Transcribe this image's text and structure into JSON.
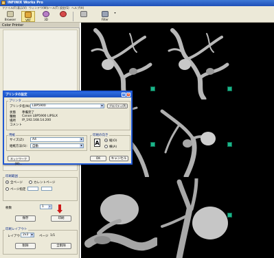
{
  "window": {
    "title": "INFINIX Works Pro"
  },
  "menu": [
    "ファイル(F)",
    "表示(V)",
    "ウィンドウ(W)",
    "ツール(T)",
    "設定(S)",
    "ヘルプ(H)"
  ],
  "toolbar": {
    "buttons": [
      {
        "label": "Browser",
        "icon": "browser-icon"
      },
      {
        "label": "VRT",
        "icon": "vrt-icon"
      },
      {
        "label": "3D",
        "icon": "3d-icon"
      },
      {
        "label": "",
        "icon": "hand-icon"
      },
      {
        "label": "",
        "icon": "monitor-icon"
      },
      {
        "label": "Filter",
        "icon": "filter-icon"
      }
    ]
  },
  "left_panel": {
    "header": "Color Printer",
    "print_range": {
      "title": "印刷範囲",
      "all_pages": "全ページ",
      "current_page": "カレントページ",
      "page_spec": "ページ指定"
    },
    "copies": {
      "label": "枚数",
      "value": "1"
    },
    "save_button": "保存",
    "print_button": "印刷",
    "layout": {
      "title": "印刷レイアウト",
      "layout_label": "レイアウト",
      "layout_value": "2x3",
      "page_label": "ページ",
      "page_value": "1/1",
      "delete_button": "削除",
      "delete_all_button": "全削除"
    }
  },
  "dialog": {
    "title": "プリンタの設定",
    "printer_group": "プリンタ",
    "name_label": "プリンタ名(N):",
    "name_value": "LBP5900",
    "properties_button": "プロパティ(P)",
    "status_label": "状態",
    "status_value": "準備完了",
    "type_label": "種類",
    "type_value": "Canon LBP5900 LIPSLX",
    "location_label": "場所",
    "location_value": "IP_192.168.14.200",
    "comment_label": "コメント",
    "paper_group": "用紙",
    "size_label": "サイズ(Z):",
    "size_value": "A4",
    "source_label": "給紙方法(S):",
    "source_value": "自動",
    "orientation_group": "印刷の向き",
    "portrait": "縦(O)",
    "landscape": "横(A)",
    "network_button": "ネットワーク(W)...",
    "ok_button": "OK",
    "cancel_button": "キャンセル"
  },
  "colors": {
    "title_bar": "#1e4fb8",
    "panel_bg": "#ece9d8",
    "viewer_bg": "#000000",
    "orientation_cube": "#1bb58a",
    "arrow": "#cc1a1a"
  }
}
